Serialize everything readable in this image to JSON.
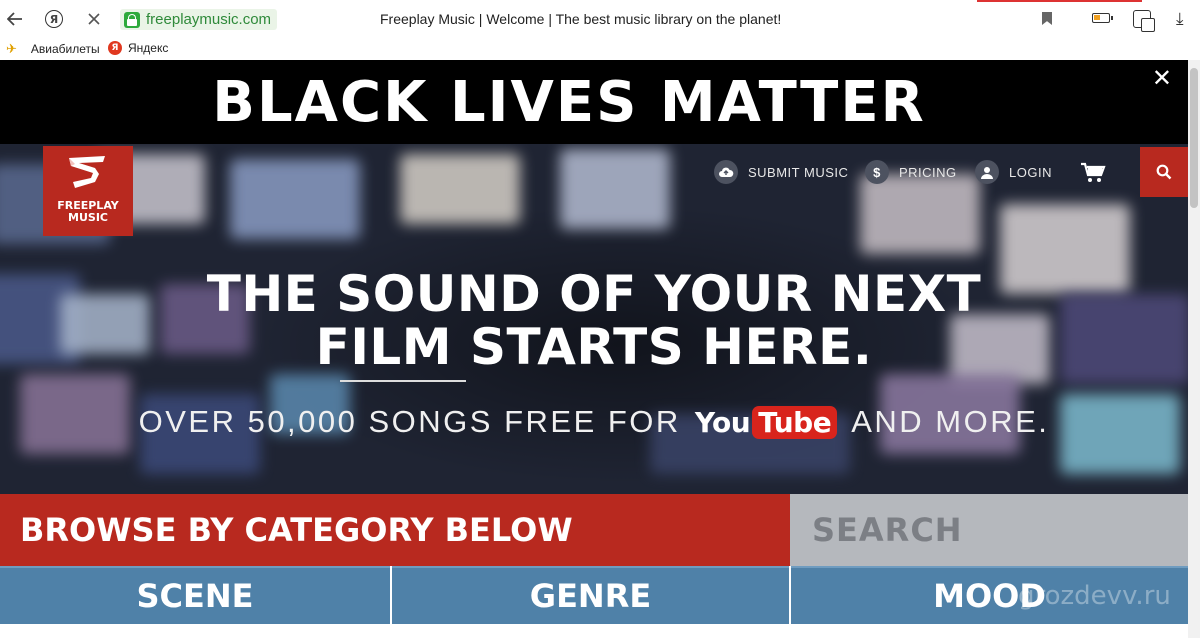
{
  "browser": {
    "back_icon": "arrow-left-icon",
    "yandex_icon": "yandex-circle-icon",
    "yandex_glyph": "Я",
    "stop_icon": "close-icon",
    "url": "freeplaymusic.com",
    "page_title": "Freeplay Music | Welcome | The best music library on the planet!",
    "accent_color": "#dd3333"
  },
  "bookmarks": [
    {
      "label": "Авиабилеты",
      "icon": "plane-icon"
    },
    {
      "label": "Яндекс",
      "icon": "yandex-icon",
      "glyph": "Я"
    }
  ],
  "banner": {
    "text": "BLACK LIVES MATTER",
    "close_icon": "close-icon"
  },
  "site": {
    "logo_text_line1": "FREEPLAY",
    "logo_text_line2": "MUSIC",
    "brand_color": "#b8291f",
    "nav": {
      "submit_music": "SUBMIT MUSIC",
      "pricing": "PRICING",
      "pricing_glyph": "$",
      "login": "LOGIN"
    },
    "hero": {
      "headline_line1": "THE SOUND OF YOUR NEXT",
      "headline_line2": "FILM STARTS HERE.",
      "sub_before": "OVER 50,000 SONGS FREE FOR",
      "youtube_you": "You",
      "youtube_tube": "Tube",
      "sub_after": "AND MORE."
    },
    "browse_label": "BROWSE BY CATEGORY BELOW",
    "search_placeholder": "SEARCH",
    "categories": [
      "SCENE",
      "GENRE",
      "MOOD"
    ],
    "watermark": "grozdevv.ru"
  }
}
